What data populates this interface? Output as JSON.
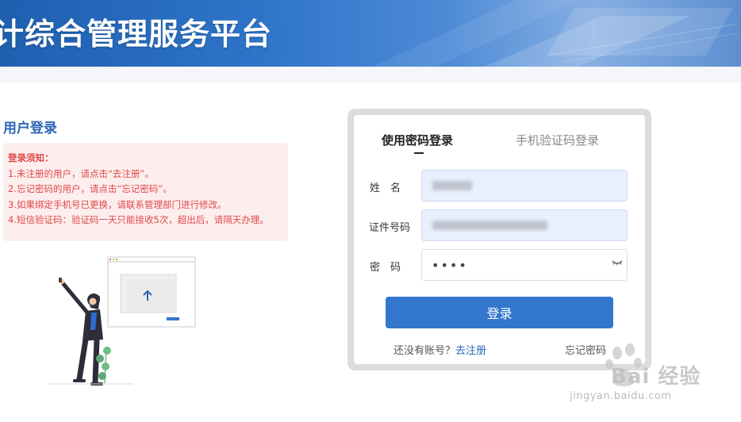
{
  "header": {
    "title": "计综合管理服务平台"
  },
  "section_title": "用户登录",
  "notice": {
    "title": "登录须知：",
    "lines": [
      "1.未注册的用户，请点击“去注册”。",
      "2.忘记密码的用户，请点击“忘记密码”。",
      "3.如果绑定手机号已更换，请联系管理部门进行修改。",
      "4.短信验证码：验证码一天只能接收5次，超出后，请隔天办理。"
    ]
  },
  "login": {
    "tabs": [
      {
        "label": "使用密码登录",
        "active": true
      },
      {
        "label": "手机验证码登录",
        "active": false
      }
    ],
    "fields": {
      "name_label": "姓　名",
      "id_label": "证件号码",
      "password_label": "密　码",
      "password_value": "••••"
    },
    "submit_label": "登录",
    "no_account_text": "还没有账号？",
    "register_label": "去注册",
    "forgot_label": "忘记密码"
  },
  "watermark": {
    "brand": "Bai  经验",
    "url": "jingyan.baidu.com"
  },
  "colors": {
    "primary": "#3377cc",
    "notice_text": "#e04848",
    "notice_bg": "#fdeeee",
    "title_blue": "#2b66b6"
  }
}
